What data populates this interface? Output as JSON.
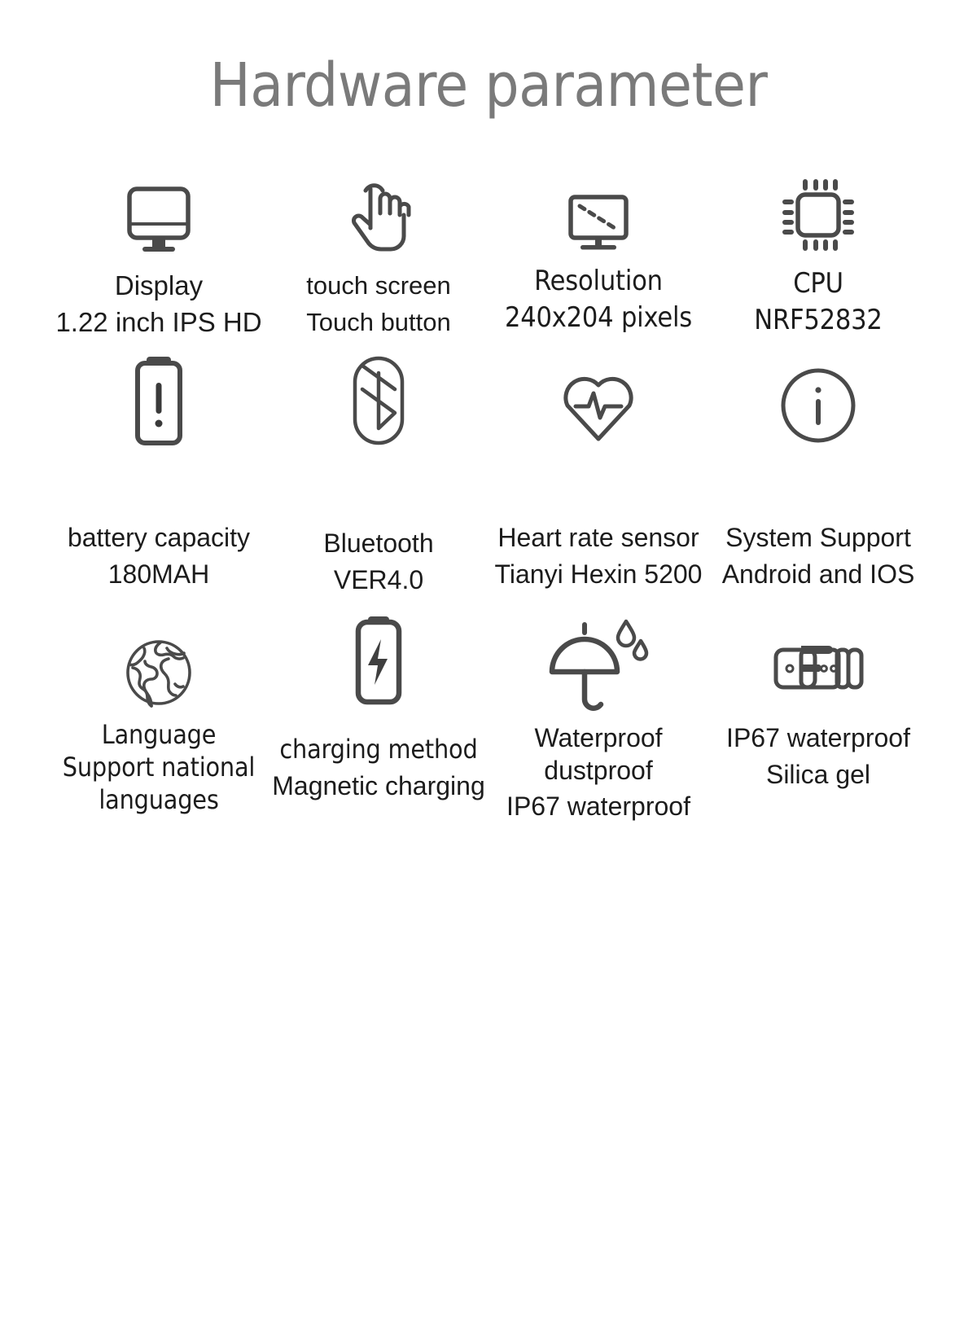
{
  "header": {
    "title": "Hardware parameter"
  },
  "theme": {
    "background": "#ffffff",
    "title_color": "#7a7a7a",
    "text_color": "#1c1c1c",
    "icon_stroke": "#4a4a4a"
  },
  "spec_rows": [
    {
      "row": 1,
      "cells": [
        {
          "icon": "monitor-display-icon",
          "lines": [
            "Display",
            "1.22 inch IPS HD"
          ]
        },
        {
          "icon": "hand-tap-touch-icon",
          "lines": [
            "touch screen",
            "Touch button"
          ]
        },
        {
          "icon": "monitor-diagonal-resolution-icon",
          "lines": [
            "Resolution",
            "240x204 pixels"
          ]
        },
        {
          "icon": "cpu-chip-icon",
          "lines": [
            "CPU",
            "NRF52832"
          ]
        }
      ]
    },
    {
      "row": 2,
      "cells": [
        {
          "icon": "battery-alert-icon",
          "lines": [
            "battery capacity",
            "180MAH"
          ]
        },
        {
          "icon": "bluetooth-icon",
          "lines": [
            "Bluetooth",
            "VER4.0"
          ]
        },
        {
          "icon": "heart-rate-pulse-icon",
          "lines": [
            "Heart rate sensor",
            "Tianyi Hexin 5200"
          ]
        },
        {
          "icon": "info-circle-icon",
          "lines": [
            "System Support",
            "Android and IOS"
          ]
        }
      ]
    },
    {
      "row": 3,
      "cells": [
        {
          "icon": "globe-language-icon",
          "lines": [
            "Language",
            "Support national",
            "languages"
          ]
        },
        {
          "icon": "battery-charging-bolt-icon",
          "lines": [
            "charging method",
            "Magnetic charging"
          ]
        },
        {
          "icon": "umbrella-raindrops-icon",
          "lines": [
            "Waterproof",
            "dustproof",
            "IP67 waterproof"
          ]
        },
        {
          "icon": "watch-strap-buckle-icon",
          "lines": [
            "IP67 waterproof",
            "Silica gel"
          ]
        }
      ]
    }
  ]
}
